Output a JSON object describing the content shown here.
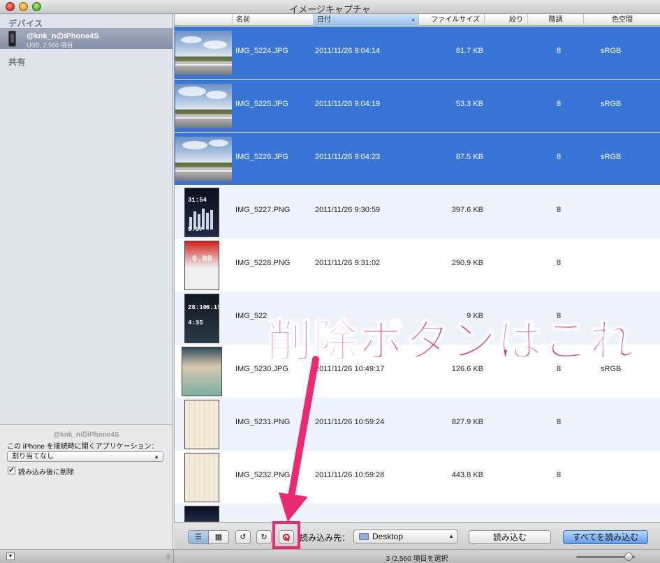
{
  "window": {
    "title": "イメージキャプチャ"
  },
  "sidebar": {
    "devices_header": "デバイス",
    "device": {
      "name": "@knk_nのiPhone4S",
      "subtitle": "USB, 2,560 項目"
    },
    "shared_header": "共有",
    "bottom": {
      "title": "@knk_nのiPhone4S",
      "app_label": "この iPhone を接続時に開くアプリケーション：",
      "app_value": "割り当てなし",
      "delete_after_import_label": "読み込み後に削除",
      "delete_after_import_checked": true
    }
  },
  "list": {
    "columns": {
      "name": "名前",
      "date": "日付",
      "size": "ファイルサイズ",
      "aperture": "絞り",
      "depth": "階調",
      "colorspace": "色空間"
    },
    "rows": [
      {
        "name": "IMG_5224.JPG",
        "date": "2011/11/26 9:04:14",
        "size": "81.7 KB",
        "depth": "8",
        "colorspace": "sRGB",
        "selected": true,
        "thumb": "landscape"
      },
      {
        "name": "IMG_5225.JPG",
        "date": "2011/11/26 9:04:19",
        "size": "53.3 KB",
        "depth": "8",
        "colorspace": "sRGB",
        "selected": true,
        "thumb": "landscape"
      },
      {
        "name": "IMG_5226.JPG",
        "date": "2011/11/26 9:04:23",
        "size": "87.5 KB",
        "depth": "8",
        "colorspace": "sRGB",
        "selected": true,
        "thumb": "landscape"
      },
      {
        "name": "IMG_5227.PNG",
        "date": "2011/11/26 9:30:59",
        "size": "397.6 KB",
        "depth": "8",
        "colorspace": "",
        "selected": false,
        "thumb": "phone-dark"
      },
      {
        "name": "IMG_5228.PNG",
        "date": "2011/11/26 9:31:02",
        "size": "290.9 KB",
        "depth": "8",
        "colorspace": "",
        "selected": false,
        "thumb": "phone-red"
      },
      {
        "name": "IMG_522",
        "date": "",
        "size": "9 KB",
        "depth": "8",
        "colorspace": "",
        "selected": false,
        "thumb": "phone-clock"
      },
      {
        "name": "IMG_5230.JPG",
        "date": "2011/11/26 10:49:17",
        "size": "126.6 KB",
        "depth": "8",
        "colorspace": "sRGB",
        "selected": false,
        "thumb": "phone-manga"
      },
      {
        "name": "IMG_5231.PNG",
        "date": "2011/11/26 10:59:24",
        "size": "827.9 KB",
        "depth": "8",
        "colorspace": "",
        "selected": false,
        "thumb": "phone-cal"
      },
      {
        "name": "IMG_5232.PNG",
        "date": "2011/11/26 10:59:28",
        "size": "443.8 KB",
        "depth": "8",
        "colorspace": "",
        "selected": false,
        "thumb": "phone-cal"
      }
    ],
    "thumb_texts": {
      "phone_dark": [
        "31:54",
        "5.97"
      ],
      "phone_red": [
        "6.08"
      ],
      "phone_clock": [
        "28:10",
        "6.15",
        "4:35"
      ]
    }
  },
  "toolbar": {
    "import_to_label": "読み込み先：",
    "destination": "Desktop",
    "import_label": "読み込む",
    "import_all_label": "すべてを読み込む"
  },
  "status": {
    "text": "3 /2,560 項目を選択"
  },
  "annotation": {
    "text": "削除ボタンはこれ",
    "color": "#ec2a74"
  },
  "colors": {
    "selection": "#3875d7",
    "alt_row": "#edf2fb",
    "sidebar": "#dee4ea"
  }
}
